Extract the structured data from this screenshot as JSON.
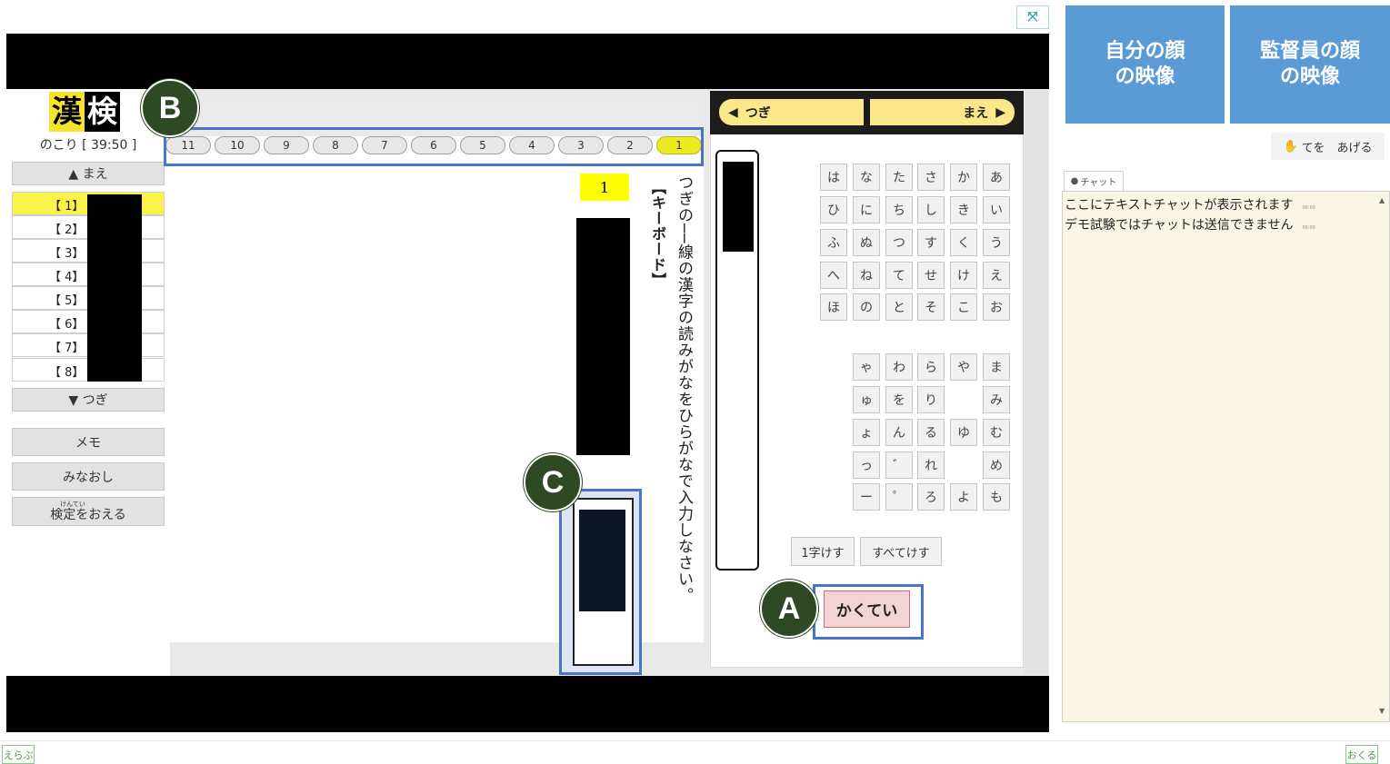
{
  "header": {
    "expand_icon": "expand-icon",
    "expand_symbol": "⤧"
  },
  "logo": {
    "char1": "漢",
    "char2": "検"
  },
  "timer": "のこり [ 39:50 ]",
  "sidebar": {
    "prev_label": "▲ まえ",
    "next_label": "▼ つぎ",
    "items": [
      {
        "label": "【 1】",
        "active": true
      },
      {
        "label": "【 2】",
        "active": false
      },
      {
        "label": "【 3】",
        "active": false
      },
      {
        "label": "【 4】",
        "active": false
      },
      {
        "label": "【 5】",
        "active": false
      },
      {
        "label": "【 6】",
        "active": false
      },
      {
        "label": "【 7】",
        "active": false
      },
      {
        "label": "【 8】",
        "active": false
      }
    ],
    "memo_label": "メモ",
    "review_label": "みなおし",
    "finish_ruby": "けんてい",
    "finish_label": "検定をおえる"
  },
  "tabs": [
    "11",
    "10",
    "9",
    "8",
    "7",
    "6",
    "5",
    "4",
    "3",
    "2",
    "1"
  ],
  "active_tab": "1",
  "question": {
    "number": "1",
    "instruction": "つぎの──線の漢字の読みがなをひらがなで入力しなさい。",
    "keyboard_label": "【キーボード】"
  },
  "keyboard": {
    "next_label": "つぎ",
    "prev_label": "まえ",
    "grid1": [
      [
        "は",
        "な",
        "た",
        "さ",
        "か",
        "あ"
      ],
      [
        "ひ",
        "に",
        "ち",
        "し",
        "き",
        "い"
      ],
      [
        "ふ",
        "ぬ",
        "つ",
        "す",
        "く",
        "う"
      ],
      [
        "へ",
        "ね",
        "て",
        "せ",
        "け",
        "え"
      ],
      [
        "ほ",
        "の",
        "と",
        "そ",
        "こ",
        "お"
      ]
    ],
    "grid2": [
      [
        "ゃ",
        "わ",
        "ら",
        "や",
        "ま"
      ],
      [
        "ゅ",
        "を",
        "り",
        "",
        "み"
      ],
      [
        "ょ",
        "ん",
        "る",
        "ゆ",
        "む"
      ],
      [
        "っ",
        "゛",
        "れ",
        "",
        "め"
      ],
      [
        "ー",
        "゜",
        "ろ",
        "よ",
        "も"
      ]
    ],
    "delete_one_label": "1字けす",
    "delete_all_label": "すべてけす",
    "confirm_label": "かくてい"
  },
  "callouts": {
    "a": "A",
    "b": "B",
    "c": "C"
  },
  "video": {
    "self_label_1": "自分の顔",
    "self_label_2": "の映像",
    "proctor_label_1": "監督員の顔",
    "proctor_label_2": "の映像"
  },
  "raise_hand": {
    "icon": "hand-icon",
    "label": "てを　あげる"
  },
  "chat": {
    "tab_label": "チャット",
    "messages": [
      "ここにテキストチャットが表示されます",
      "デモ試験ではチャットは送信できません"
    ],
    "time": "00:00"
  },
  "footer": {
    "select_label": "えらぶ",
    "send_label": "おくる"
  },
  "colors": {
    "accent_blue": "#4a74c8",
    "callout_green": "#2d4a24",
    "highlight_yellow": "#ffff00",
    "video_blue": "#5b9bd5"
  }
}
